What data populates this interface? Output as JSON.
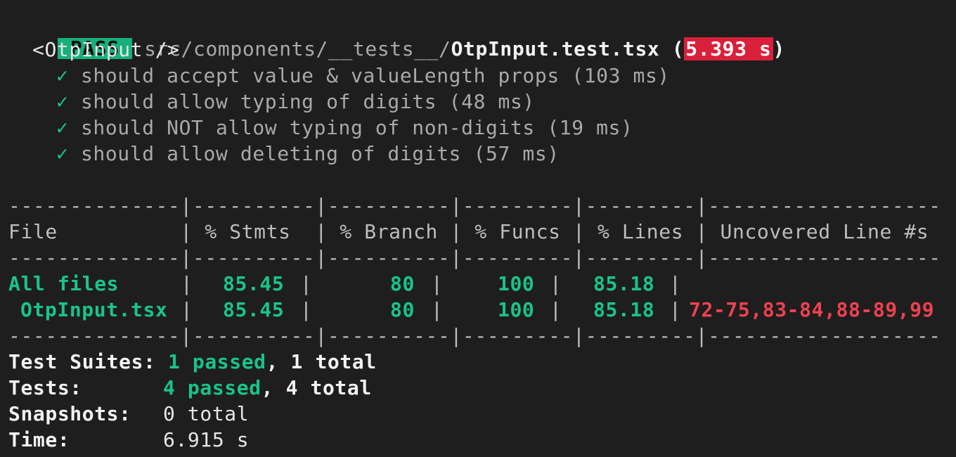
{
  "header": {
    "status": "PASS",
    "path_prefix": "src/components/__tests__/",
    "file": "OtpInput.test.tsx",
    "open_paren": " (",
    "duration": "5.393 s",
    "close_paren": ")"
  },
  "suite": {
    "name": "<OtpInput />",
    "tests": [
      {
        "check": "✓",
        "text": "should accept value & valueLength props (103 ms)"
      },
      {
        "check": "✓",
        "text": "should allow typing of digits (48 ms)"
      },
      {
        "check": "✓",
        "text": "should NOT allow typing of non-digits (19 ms)"
      },
      {
        "check": "✓",
        "text": "should allow deleting of digits (57 ms)"
      }
    ]
  },
  "coverage": {
    "separator": "--------------|----------|----------|---------|---------|-------------------",
    "header": "File          | % Stmts  | % Branch | % Funcs | % Lines | Uncovered Line #s",
    "rows": [
      {
        "file": "All files",
        "stmts": "85.45",
        "branch": "80",
        "funcs": "100",
        "lines": "85.18",
        "uncovered": ""
      },
      {
        "file": "OtpInput.tsx",
        "stmts": "85.45",
        "branch": "80",
        "funcs": "100",
        "lines": "85.18",
        "uncovered": "72-75,83-84,88-89,99"
      }
    ]
  },
  "summary": {
    "suites_label": "Test Suites:",
    "suites_passed": "1 passed",
    "suites_total": ", 1 total",
    "tests_label": "Tests:",
    "tests_passed": "4 passed",
    "tests_total": ", 4 total",
    "snapshots_label": "Snapshots:",
    "snapshots_value": "0 total",
    "time_label": "Time:",
    "time_value": "6.915 s"
  },
  "colors": {
    "background": "#1e1e1e",
    "pass": "#16b07a",
    "check": "#19c48a",
    "fail_red": "#ef4150",
    "time_badge": "#d8203a"
  }
}
